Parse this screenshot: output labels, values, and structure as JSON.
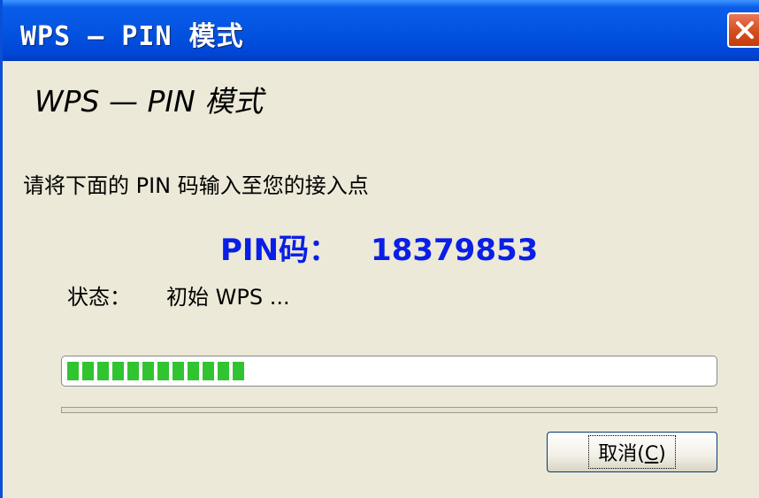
{
  "window": {
    "title": "WPS — PIN 模式",
    "accent_color": "#0a5de9",
    "close_icon": "close-icon"
  },
  "header": {
    "title": "WPS — PIN 模式"
  },
  "body": {
    "instruction": "请将下面的 PIN 码输入至您的接入点",
    "pin_label": "PIN码：",
    "pin_value": "18379853",
    "status_label": "状态：",
    "status_value": "初始 WPS ..."
  },
  "progress": {
    "fraction": 0.28,
    "color": "#31c431"
  },
  "buttons": {
    "cancel_prefix": "取消(",
    "cancel_hotkey": "C",
    "cancel_suffix": ")"
  }
}
